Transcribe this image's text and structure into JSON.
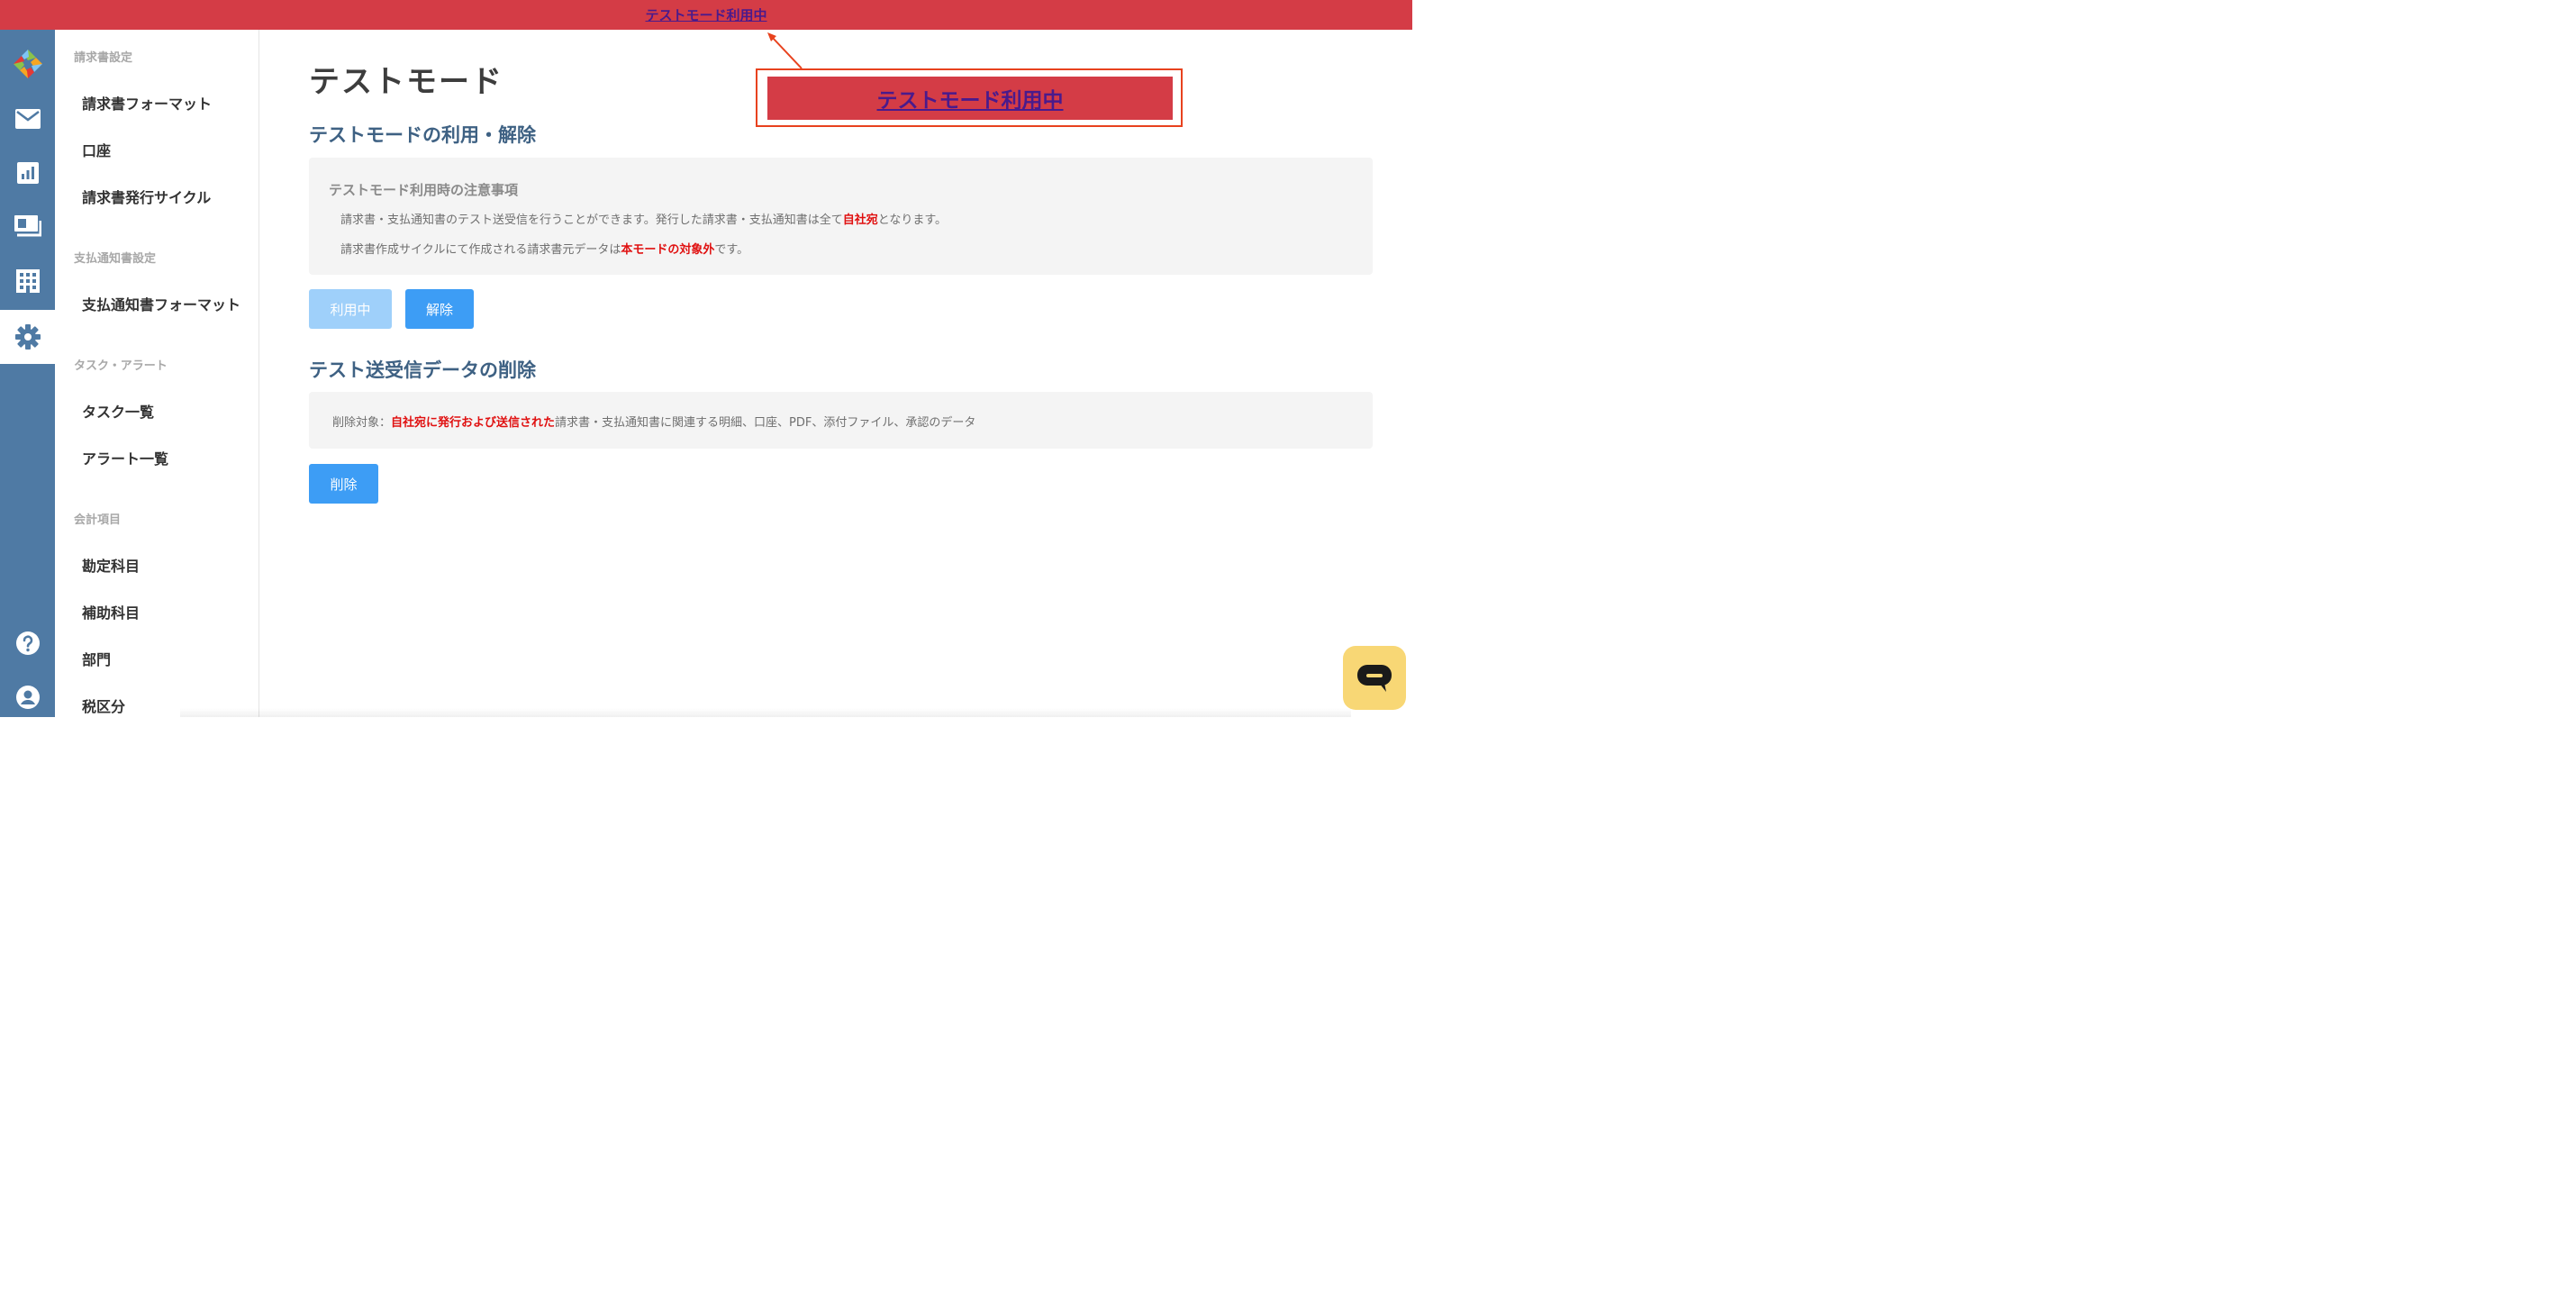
{
  "banner": {
    "label": "テストモード利用中"
  },
  "colors": {
    "banner": "#d43c46",
    "rail": "#4f7aa4",
    "accent": "#3d9df5",
    "emphasis": "#e01010"
  },
  "rail": {
    "icons": [
      "logo-icon",
      "mail-icon",
      "chart-icon",
      "payment-icon",
      "building-icon",
      "gear-icon",
      "help-icon",
      "user-icon"
    ],
    "active": "gear-icon"
  },
  "sidebar": {
    "groups": [
      {
        "title": "請求書設定",
        "items": [
          "請求書フォーマット",
          "口座",
          "請求書発行サイクル"
        ]
      },
      {
        "title": "支払通知書設定",
        "items": [
          "支払通知書フォーマット"
        ]
      },
      {
        "title": "タスク・アラート",
        "items": [
          "タスク一覧",
          "アラート一覧"
        ]
      },
      {
        "title": "会計項目",
        "items": [
          "勘定科目",
          "補助科目",
          "部門",
          "税区分"
        ]
      }
    ]
  },
  "main": {
    "title": "テストモード",
    "section1": {
      "title": "テストモードの利用・解除",
      "notice_heading": "テストモード利用時の注意事項",
      "line1": {
        "before": "請求書・支払通知書のテスト送受信を行うことができます。発行した請求書・支払通知書は全て",
        "emphasis": "自社宛",
        "after": "となります。"
      },
      "line2": {
        "before": "請求書作成サイクルにて作成される請求書元データは",
        "emphasis": "本モードの対象外",
        "after": "です。"
      },
      "button_in_use": "利用中",
      "button_release": "解除"
    },
    "section2": {
      "title": "テスト送受信データの削除",
      "line": {
        "before": "削除対象：",
        "emphasis": "自社宛に発行および送信された",
        "after": "請求書・支払通知書に関連する明細、口座、PDF、添付ファイル、承認のデータ"
      },
      "button_delete": "削除"
    }
  },
  "callout": {
    "label": "テストモード利用中"
  },
  "chat": {
    "icon": "chat-icon"
  }
}
